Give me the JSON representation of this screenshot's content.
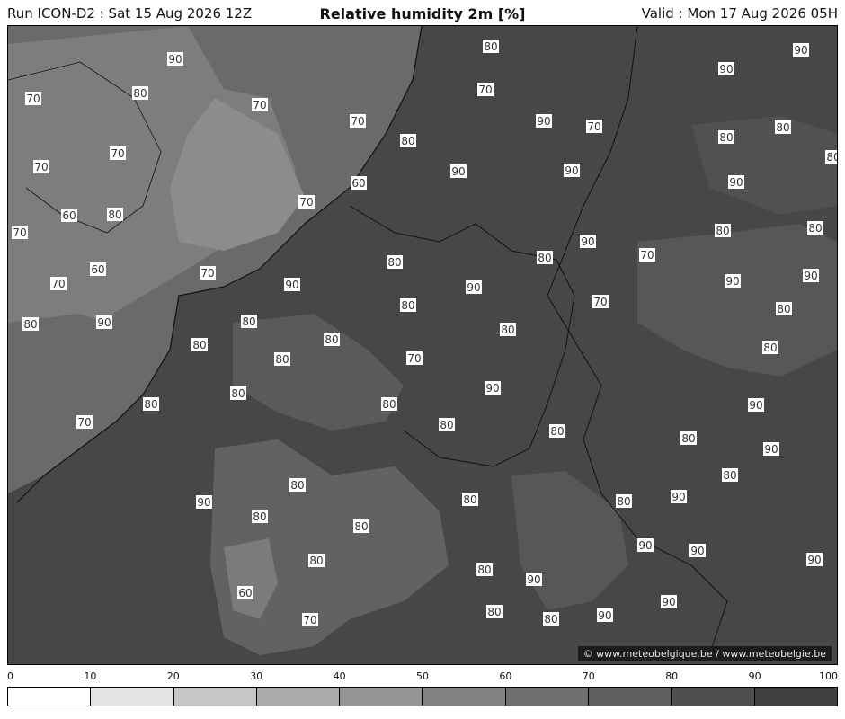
{
  "header": {
    "run": "Run ICON-D2 : Sat 15 Aug 2026 12Z",
    "title": "Relative humidity 2m [%]",
    "valid": "Valid : Mon 17 Aug 2026 05H"
  },
  "credit": "© www.meteobelgique.be / www.meteobelgie.be",
  "colorbar": {
    "ticks": [
      "0",
      "10",
      "20",
      "30",
      "40",
      "50",
      "60",
      "70",
      "80",
      "90",
      "100"
    ],
    "colors": [
      "#ffffff",
      "#e3e3e3",
      "#c6c6c6",
      "#ababab",
      "#959595",
      "#828282",
      "#707070",
      "#5f5f5f",
      "#4f4f4f",
      "#414141"
    ]
  },
  "map": {
    "contour_labels": [
      "90",
      "80",
      "70",
      "70",
      "80",
      "70",
      "70",
      "80",
      "70",
      "70",
      "60",
      "70",
      "60",
      "80",
      "70",
      "60",
      "70",
      "70",
      "80",
      "90",
      "90",
      "70",
      "90",
      "90",
      "90",
      "90",
      "80",
      "80",
      "90",
      "80",
      "90",
      "80",
      "80",
      "70",
      "80",
      "90",
      "90",
      "80",
      "80",
      "90",
      "90",
      "80",
      "70",
      "80",
      "80",
      "80",
      "80",
      "80",
      "80",
      "70",
      "80",
      "80",
      "90",
      "90",
      "80",
      "70",
      "80",
      "80",
      "80",
      "90",
      "80",
      "80",
      "80",
      "80",
      "90",
      "80",
      "90",
      "90",
      "80",
      "80",
      "90",
      "90",
      "90",
      "90",
      "90",
      "60",
      "70",
      "80",
      "80",
      "80"
    ]
  }
}
